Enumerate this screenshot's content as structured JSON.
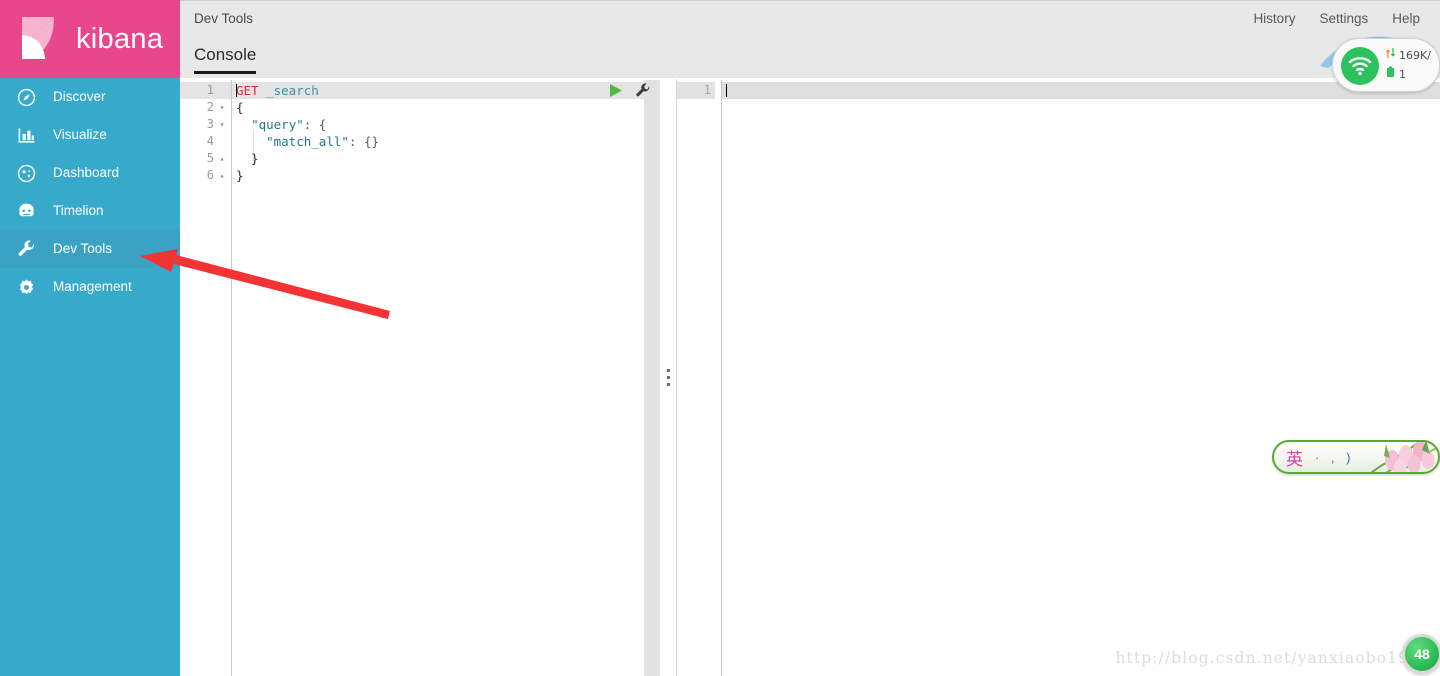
{
  "brand": {
    "name": "kibana",
    "logo_icon": "kibana-k-logo",
    "bar_color": "#e8488b",
    "sidebar_color": "#37aacc",
    "active_item_color": "#3aa3c4"
  },
  "sidebar": {
    "items": [
      {
        "label": "Discover",
        "icon": "compass-icon",
        "active": false
      },
      {
        "label": "Visualize",
        "icon": "bar-chart-icon",
        "active": false
      },
      {
        "label": "Dashboard",
        "icon": "dashboard-icon",
        "active": false
      },
      {
        "label": "Timelion",
        "icon": "timelion-icon",
        "active": false
      },
      {
        "label": "Dev Tools",
        "icon": "wrench-icon",
        "active": true
      },
      {
        "label": "Management",
        "icon": "gear-icon",
        "active": false
      }
    ]
  },
  "header": {
    "app_title": "Dev Tools",
    "links": [
      {
        "label": "History"
      },
      {
        "label": "Settings"
      },
      {
        "label": "Help"
      }
    ]
  },
  "tabs": [
    {
      "label": "Console",
      "active": true
    }
  ],
  "console": {
    "editor": {
      "lines": [
        {
          "num": "1",
          "fold": "",
          "highlight": true,
          "tokens": [
            {
              "text": "GET",
              "type": "method"
            },
            {
              "text": " ",
              "type": "plain"
            },
            {
              "text": "_search",
              "type": "url"
            }
          ]
        },
        {
          "num": "2",
          "fold": "down",
          "highlight": false,
          "tokens": [
            {
              "text": "{",
              "type": "brace"
            }
          ]
        },
        {
          "num": "3",
          "fold": "down",
          "highlight": false,
          "tokens": [
            {
              "text": "  ",
              "type": "plain"
            },
            {
              "text": "\"query\"",
              "type": "key"
            },
            {
              "text": ": {",
              "type": "punct"
            }
          ]
        },
        {
          "num": "4",
          "fold": "",
          "highlight": false,
          "tokens": [
            {
              "text": "    ",
              "type": "plain"
            },
            {
              "text": "\"match_all\"",
              "type": "key"
            },
            {
              "text": ": {}",
              "type": "punct"
            }
          ]
        },
        {
          "num": "5",
          "fold": "up",
          "highlight": false,
          "tokens": [
            {
              "text": "  }",
              "type": "brace"
            }
          ]
        },
        {
          "num": "6",
          "fold": "up",
          "highlight": false,
          "tokens": [
            {
              "text": "}",
              "type": "brace"
            }
          ]
        }
      ],
      "play_button_label": "Click to send request",
      "wrench_button_label": "Open documentation / settings"
    },
    "output": {
      "lines": [
        {
          "num": "1",
          "text": ""
        }
      ]
    },
    "splitter_icon": "vertical-drag-handle-icon"
  },
  "overlays": {
    "annotation_arrow": "red-arrow-pointing-to-dev-tools",
    "network_widget": {
      "icon": "wifi-icon",
      "speed": "169K/",
      "connections": "1",
      "speed_icon": "up-down-arrows-icon",
      "battery_icon": "battery-icon"
    },
    "ime_toolbar": {
      "mode_char": "英",
      "glyphs": "· , )",
      "decoration": "tulip-flowers-image"
    },
    "watermark": "http://blog.csdn.net/yanxiaobo199",
    "badge": {
      "value": "48",
      "color": "#2fbd55"
    }
  }
}
